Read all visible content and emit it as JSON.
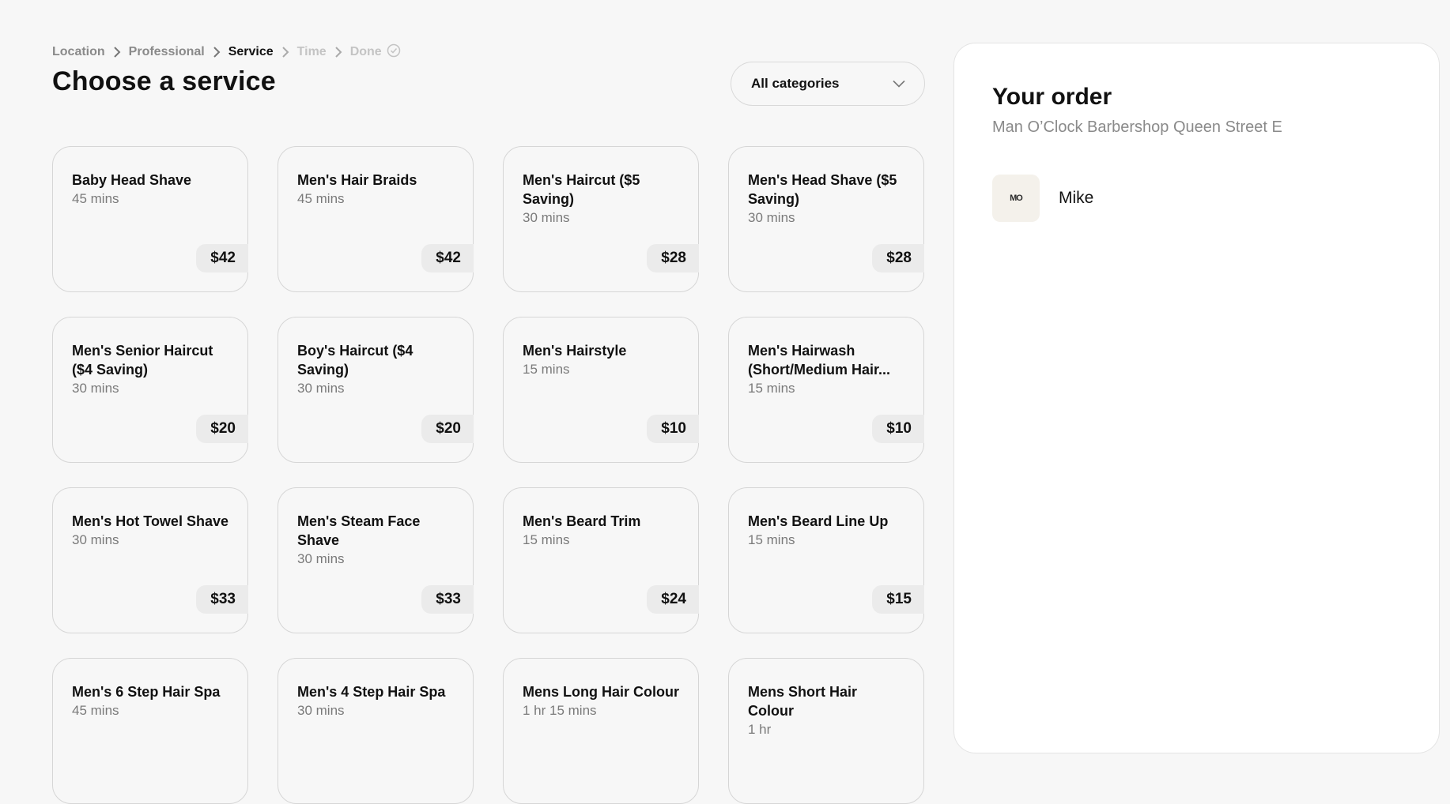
{
  "breadcrumb": {
    "location": "Location",
    "professional": "Professional",
    "service": "Service",
    "time": "Time",
    "done": "Done"
  },
  "page_title": "Choose a service",
  "category_filter": {
    "selected": "All categories"
  },
  "services": [
    {
      "name": "Baby Head Shave",
      "duration": "45 mins",
      "price": "$42"
    },
    {
      "name": "Men's Hair Braids",
      "duration": "45 mins",
      "price": "$42"
    },
    {
      "name": "Men's Haircut ($5 Saving)",
      "duration": "30 mins",
      "price": "$28"
    },
    {
      "name": "Men's Head Shave ($5 Saving)",
      "duration": "30 mins",
      "price": "$28"
    },
    {
      "name": "Men's Senior Haircut ($4 Saving)",
      "duration": "30 mins",
      "price": "$20"
    },
    {
      "name": "Boy's Haircut ($4 Saving)",
      "duration": "30 mins",
      "price": "$20"
    },
    {
      "name": "Men's Hairstyle",
      "duration": "15 mins",
      "price": "$10"
    },
    {
      "name": "Men's Hairwash (Short/Medium Hair...",
      "duration": "15 mins",
      "price": "$10"
    },
    {
      "name": "Men's Hot Towel Shave",
      "duration": "30 mins",
      "price": "$33"
    },
    {
      "name": "Men's Steam Face Shave",
      "duration": "30 mins",
      "price": "$33"
    },
    {
      "name": "Men's Beard Trim",
      "duration": "15 mins",
      "price": "$24"
    },
    {
      "name": "Men's Beard Line Up",
      "duration": "15 mins",
      "price": "$15"
    },
    {
      "name": "Men's 6 Step Hair Spa",
      "duration": "45 mins",
      "price": ""
    },
    {
      "name": "Men's 4 Step Hair Spa",
      "duration": "30 mins",
      "price": ""
    },
    {
      "name": "Mens Long Hair Colour",
      "duration": "1 hr 15 mins",
      "price": ""
    },
    {
      "name": "Mens Short Hair Colour",
      "duration": "1 hr",
      "price": ""
    }
  ],
  "order": {
    "title": "Your order",
    "shop": "Man O’Clock Barbershop Queen Street E",
    "staff": {
      "name": "Mike",
      "avatar_text": "MO"
    }
  },
  "icons": {
    "breadcrumb_separator": "chevron-right-icon",
    "done": "check-circle-icon",
    "select": "chevron-down-icon"
  }
}
